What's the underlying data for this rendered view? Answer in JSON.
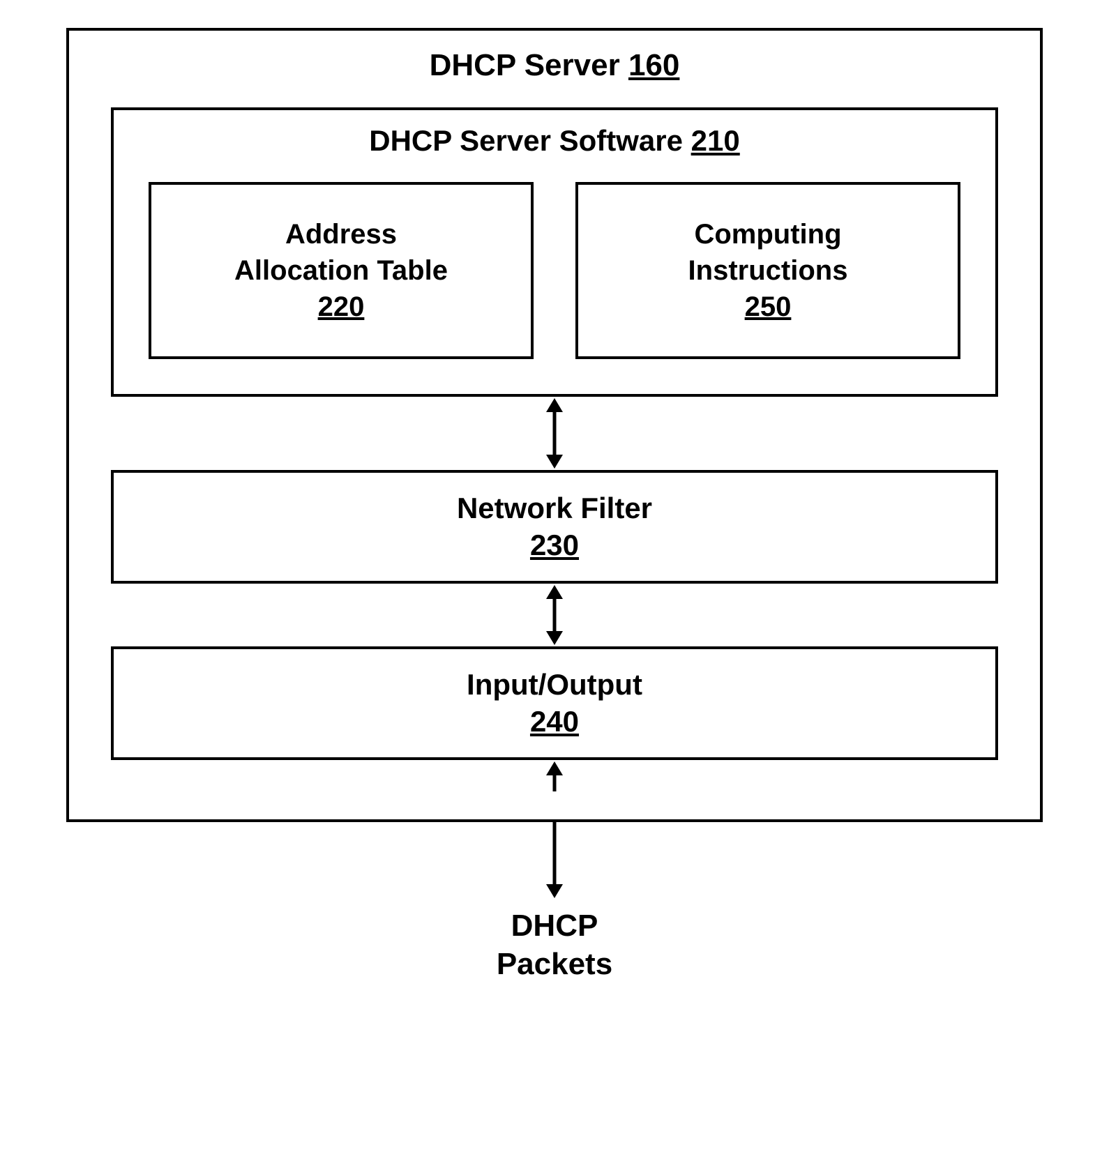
{
  "outer": {
    "title_prefix": "DHCP Server ",
    "title_ref": "160"
  },
  "software": {
    "title_prefix": "DHCP Server Software ",
    "title_ref": "210",
    "left": {
      "line1": "Address",
      "line2": "Allocation Table",
      "ref": "220"
    },
    "right": {
      "line1": "Computing",
      "line2": "Instructions",
      "ref": "250"
    }
  },
  "filter": {
    "label": "Network Filter",
    "ref": "230"
  },
  "io": {
    "label": "Input/Output",
    "ref": "240"
  },
  "bottom": {
    "line1": "DHCP",
    "line2": "Packets"
  }
}
